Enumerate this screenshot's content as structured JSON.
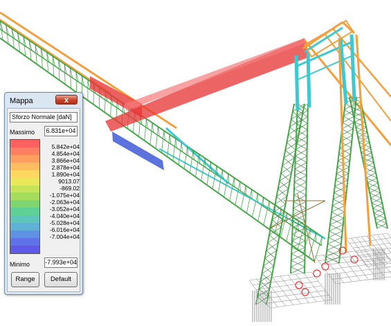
{
  "legend": {
    "title": "Mappa",
    "close_label": "x",
    "quantity": "Sforzo Normale [daN]",
    "max_label": "Massimo",
    "max_value": "6.831e+04",
    "min_label": "Minimo",
    "min_value": "-7.993e+04",
    "scale_labels": [
      "5.842e+04",
      "4.854e+04",
      "3.866e+04",
      "2.878e+04",
      "1.890e+04",
      "9013.07",
      "-869.02",
      "-1.075e+04",
      "-2.063e+04",
      "-3.052e+04",
      "-4.040e+04",
      "-5.028e+04",
      "-6.016e+04",
      "-7.004e+04"
    ],
    "colors": [
      "#ff6060",
      "#ff7f62",
      "#ff9e60",
      "#ffbd5f",
      "#ffd65e",
      "#e8e85a",
      "#c7e35a",
      "#a5dc5c",
      "#7fd670",
      "#5ecf95",
      "#5ec5b9",
      "#5fb1d6",
      "#5f92e5",
      "#5f72e8",
      "#6058e6"
    ],
    "range_label": "Range",
    "default_label": "Default"
  },
  "model": {
    "colors": {
      "tension": "#e8383a",
      "compression": "#3f59d6",
      "neutral": "#47a84a",
      "low_tension": "#f2a03c",
      "cyan": "#3ec9cf",
      "mesh": "#9a9a9a"
    }
  }
}
